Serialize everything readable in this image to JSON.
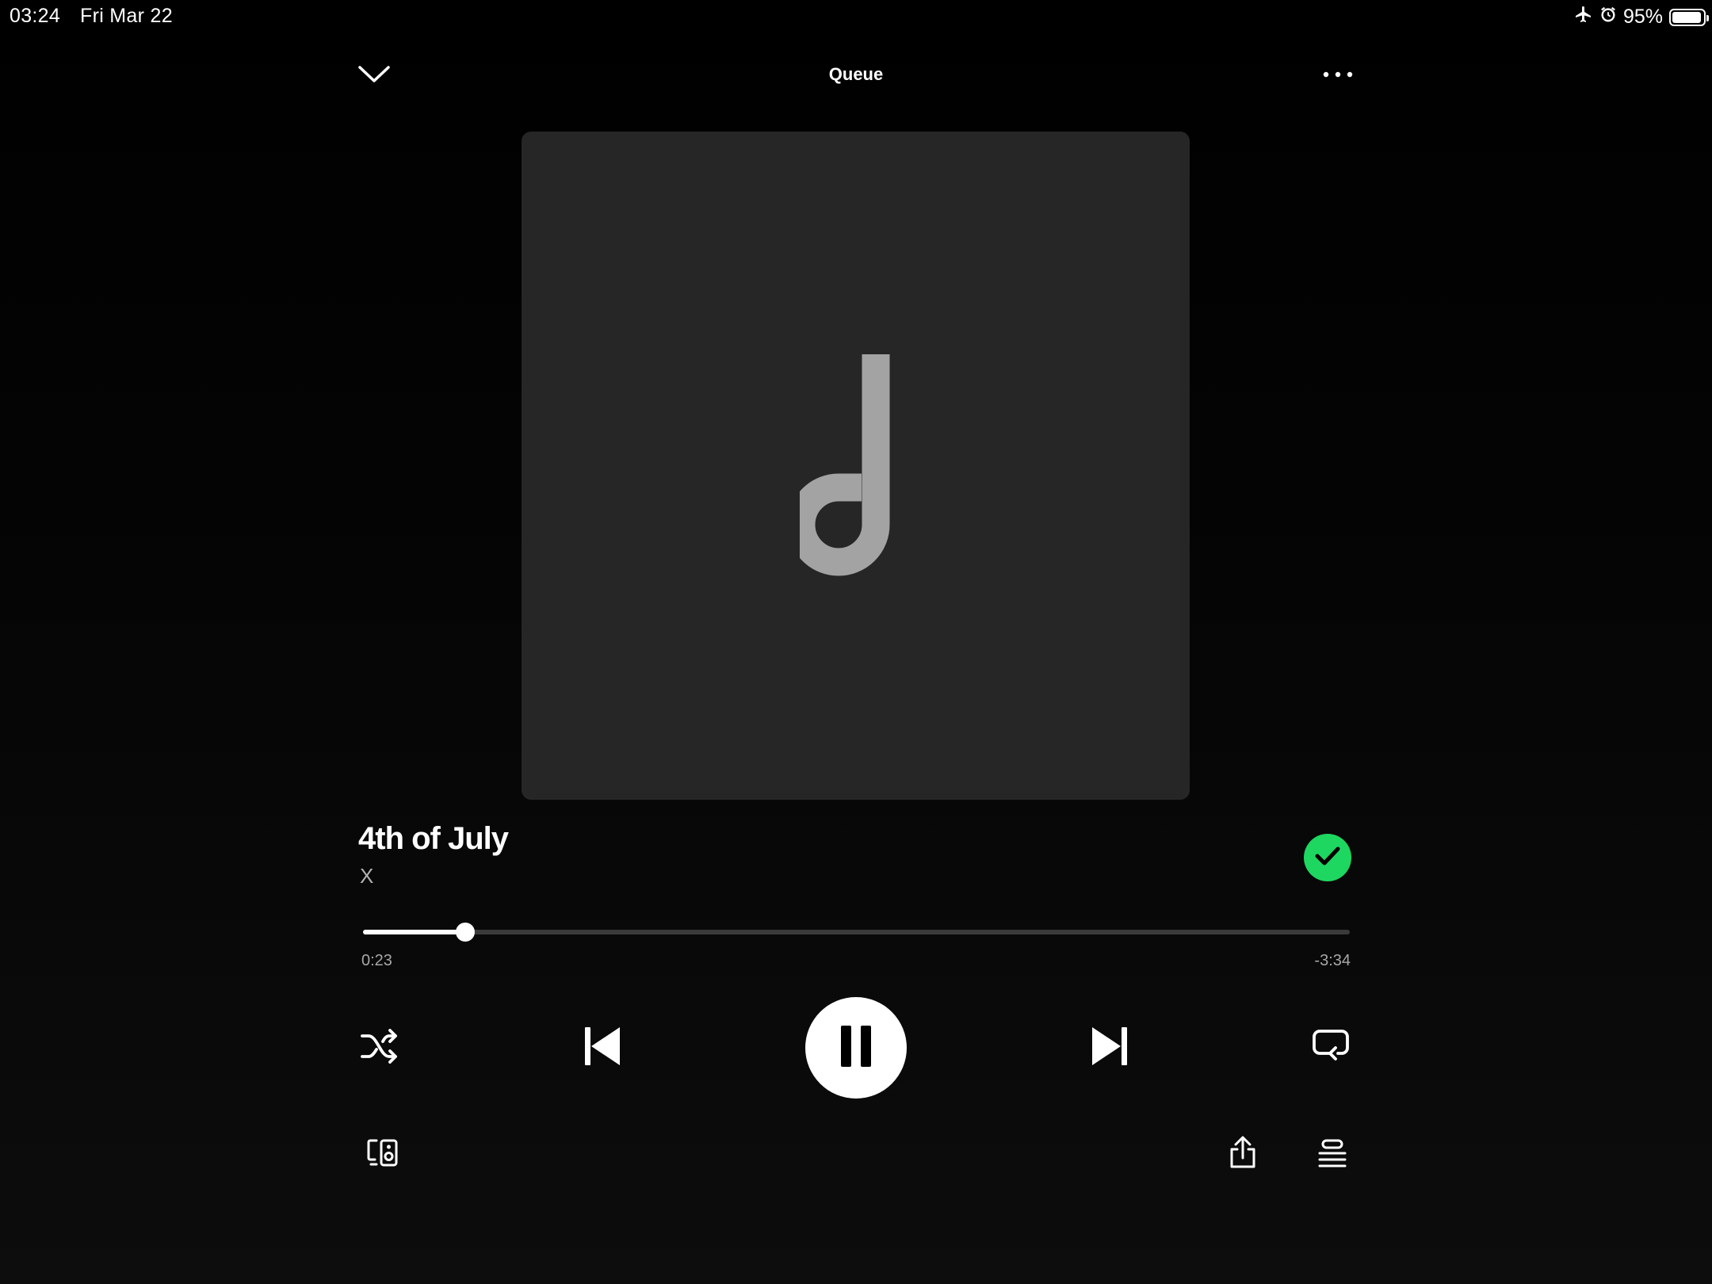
{
  "status_bar": {
    "time": "03:24",
    "date": "Fri Mar 22",
    "battery_text": "95%",
    "battery_level": 0.95,
    "icons": [
      "airplane-mode-icon",
      "alarm-icon",
      "battery-icon"
    ]
  },
  "header": {
    "title": "Queue",
    "icons": [
      "chevron-down-icon",
      "more-options-icon"
    ]
  },
  "artwork": {
    "placeholder_icon": "music-note-icon",
    "background_color": "#262626"
  },
  "track": {
    "title": "4th of July",
    "artist": "X",
    "saved": true,
    "saved_color": "#1ed760"
  },
  "progress": {
    "elapsed": "0:23",
    "remaining": "-3:34",
    "fraction": 0.104
  },
  "controls": {
    "icons": [
      "shuffle-icon",
      "previous-icon",
      "pause-icon",
      "next-icon",
      "repeat-icon"
    ]
  },
  "footer": {
    "icons": [
      "connect-device-icon",
      "share-icon",
      "queue-list-icon"
    ]
  }
}
